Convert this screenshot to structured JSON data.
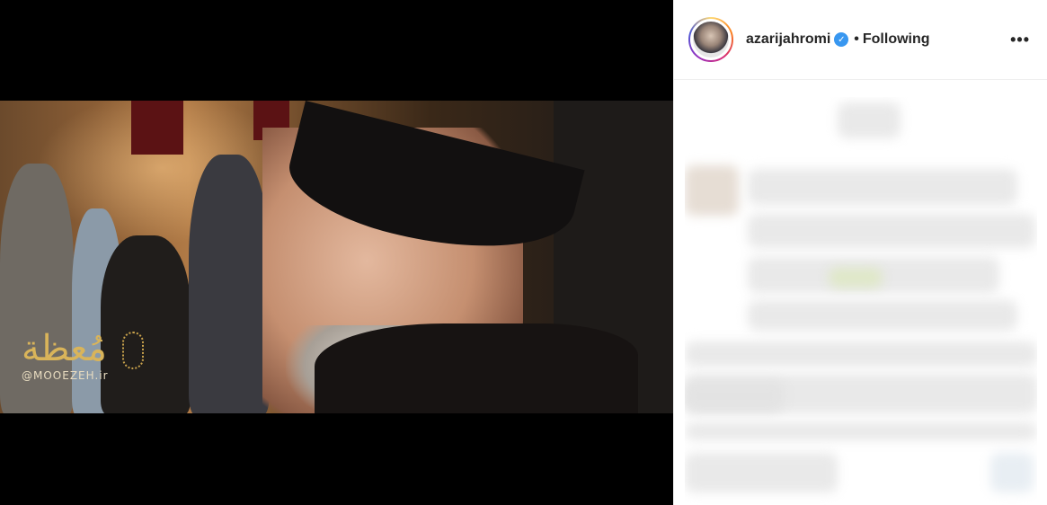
{
  "video": {
    "watermark_script": "مُعظة",
    "watermark_handle": "@MOOEZEH.ir"
  },
  "post": {
    "username": "azarijahromi",
    "verified_icon": "verified-badge-icon",
    "separator": "•",
    "follow_status": "Following",
    "more_label": "•••"
  }
}
